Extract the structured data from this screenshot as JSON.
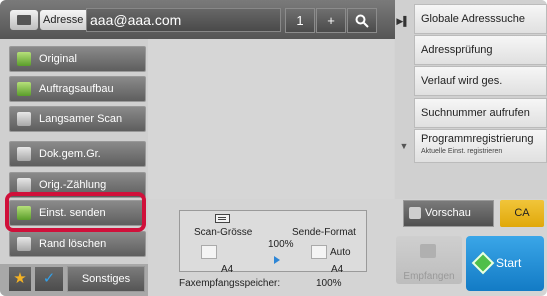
{
  "topbar": {
    "address_label": "Adresse",
    "address_value": "aaa@aaa.com",
    "count": "1",
    "plus": "+",
    "search_icon": "search-icon",
    "address_book_icon": "address-book-icon"
  },
  "left_buttons": [
    {
      "label": "Original",
      "icon": "document-icon"
    },
    {
      "label": "Auftragsaufbau",
      "icon": "document-stack-icon"
    },
    {
      "label": "Langsamer Scan",
      "icon": "scanner-icon"
    },
    {
      "label": "Dok.gem.Gr.",
      "icon": "mixed-size-icon"
    },
    {
      "label": "Orig.-Zählung",
      "icon": "counter-icon"
    },
    {
      "label": "Einst. senden",
      "icon": "send-settings-icon"
    },
    {
      "label": "Rand löschen",
      "icon": "erase-icon"
    }
  ],
  "bottom_left": {
    "star_icon": "star-icon",
    "check_icon": "checkmark-icon",
    "other_label": "Sonstiges"
  },
  "info": {
    "scan_size_label": "Scan-Grösse",
    "send_format_label": "Sende-Format",
    "ratio": "100%",
    "send_format_value": "Auto",
    "scan_size_value": "A4",
    "send_size_value": "A4",
    "fax_memory_label": "Faxempfangsspeicher:",
    "fax_memory_value": "100%"
  },
  "right_panel": {
    "items": [
      {
        "label": "Globale Adresssuche"
      },
      {
        "label": "Adressprüfung"
      },
      {
        "label": "Verlauf wird ges."
      },
      {
        "label": "Suchnummer aufrufen"
      },
      {
        "label": "Programmregistrierung",
        "sub": "Aktuelle Einst. registrieren"
      }
    ]
  },
  "actions": {
    "preview_label": "Vorschau",
    "ca_label": "CA",
    "receive_label": "Empfangen",
    "start_label": "Start"
  },
  "colors": {
    "highlight": "#d0103a",
    "start_button": "#1f8fd8",
    "ca_button": "#e8b51e"
  }
}
